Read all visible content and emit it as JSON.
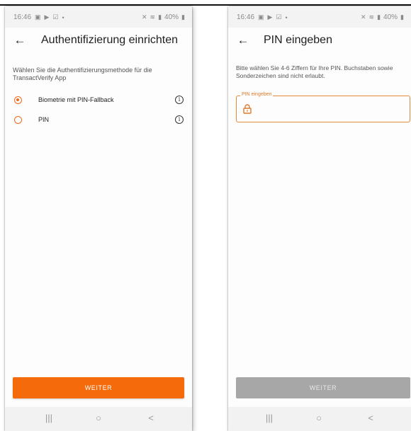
{
  "status_bar": {
    "time": "16:46",
    "battery": "40%",
    "left_icons": [
      "gallery-icon",
      "play-store-icon",
      "check-notification-icon",
      "dot-icon"
    ],
    "right_icons": [
      "mute-icon",
      "wifi-icon",
      "signal-icon"
    ]
  },
  "screen1": {
    "title": "Authentifizierung einrichten",
    "description": "Wählen Sie die Authentifizierungsmethode für die TransactVerify App",
    "options": [
      {
        "label": "Biometrie mit PIN-Fallback",
        "selected": true
      },
      {
        "label": "PIN",
        "selected": false
      }
    ],
    "button_label": "WEITER"
  },
  "screen2": {
    "title": "PIN eingeben",
    "description": "Bitte wählen Sie 4-6 Ziffern für Ihre PIN. Buchstaben sowie Sonderzeichen sind nicht erlaubt.",
    "pin_label": "PIN eingeben",
    "pin_value": "",
    "button_label": "WEITER",
    "button_enabled": false
  },
  "nav_bar": {
    "recents": "|||",
    "home": "○",
    "back": "<"
  },
  "colors": {
    "accent": "#f56a0a",
    "disabled": "#a7a7a7",
    "field_border": "#e38a3a"
  }
}
